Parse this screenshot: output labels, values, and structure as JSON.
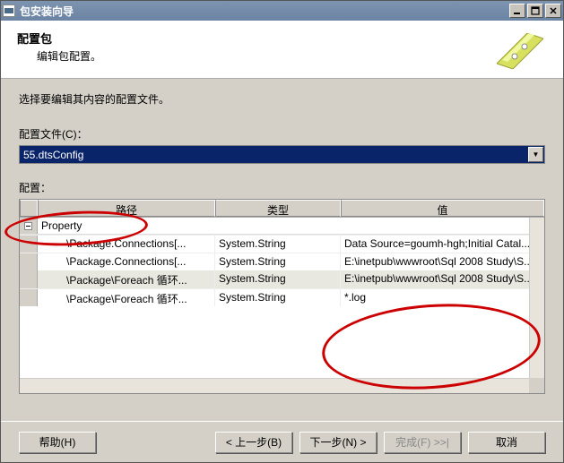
{
  "window": {
    "title": "包安装向导"
  },
  "header": {
    "title": "配置包",
    "subtitle": "编辑包配置。"
  },
  "body": {
    "instruction": "选择要编辑其内容的配置文件。",
    "config_file_label": "配置文件(C)：",
    "config_file_value": "55.dtsConfig",
    "config_label": "配置：",
    "grid": {
      "columns": {
        "path": "路径",
        "type": "类型",
        "value": "值"
      },
      "property_label": "Property",
      "rows": [
        {
          "path": "\\Package.Connections[...",
          "type": "System.String",
          "value": "Data Source=goumh-hgh;Initial Catal..."
        },
        {
          "path": "\\Package.Connections[...",
          "type": "System.String",
          "value": "E:\\inetpub\\wwwroot\\Sql 2008 Study\\S..."
        },
        {
          "path": "\\Package\\Foreach 循环...",
          "type": "System.String",
          "value": "E:\\inetpub\\wwwroot\\Sql 2008 Study\\S..."
        },
        {
          "path": "\\Package\\Foreach 循环...",
          "type": "System.String",
          "value": "*.log"
        }
      ]
    }
  },
  "footer": {
    "help": "帮助(H)",
    "back": "< 上一步(B)",
    "next": "下一步(N) >",
    "finish": "完成(F) >>|",
    "cancel": "取消"
  }
}
